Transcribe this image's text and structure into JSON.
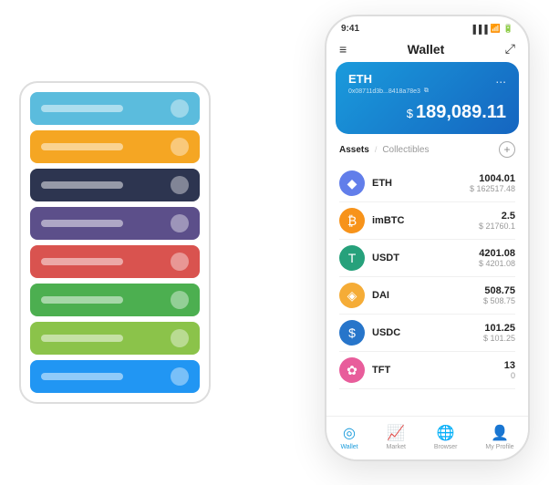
{
  "scene": {
    "cardStack": {
      "cards": [
        {
          "color": "#5bbcdd",
          "iconBg": "rgba(255,255,255,0.4)"
        },
        {
          "color": "#f5a623",
          "iconBg": "rgba(255,255,255,0.4)"
        },
        {
          "color": "#2d3550",
          "iconBg": "rgba(255,255,255,0.4)"
        },
        {
          "color": "#5c4f8a",
          "iconBg": "rgba(255,255,255,0.4)"
        },
        {
          "color": "#d9534f",
          "iconBg": "rgba(255,255,255,0.4)"
        },
        {
          "color": "#4caf50",
          "iconBg": "rgba(255,255,255,0.4)"
        },
        {
          "color": "#8bc34a",
          "iconBg": "rgba(255,255,255,0.4)"
        },
        {
          "color": "#2196f3",
          "iconBg": "rgba(255,255,255,0.4)"
        }
      ]
    },
    "phone": {
      "statusBar": {
        "time": "9:41",
        "signal": "▐▐▐",
        "wifi": "wifi",
        "battery": "▭"
      },
      "header": {
        "menuIcon": "≡",
        "title": "Wallet",
        "expandIcon": "⤢"
      },
      "ethCard": {
        "title": "ETH",
        "moreIcon": "...",
        "address": "0x08711d3b...8418a78e3",
        "addressIcon": "⧉",
        "currencySymbol": "$",
        "amount": "189,089.11"
      },
      "assets": {
        "tabActive": "Assets",
        "tabDivider": "/",
        "tabInactive": "Collectibles",
        "addButtonLabel": "+"
      },
      "assetList": [
        {
          "name": "ETH",
          "iconColor": "#627eea",
          "iconSymbol": "♦",
          "amountMain": "1004.01",
          "amountUsd": "$ 162517.48"
        },
        {
          "name": "imBTC",
          "iconColor": "#f7931a",
          "iconSymbol": "₿",
          "amountMain": "2.5",
          "amountUsd": "$ 21760.1"
        },
        {
          "name": "USDT",
          "iconColor": "#26a17b",
          "iconSymbol": "T",
          "amountMain": "4201.08",
          "amountUsd": "$ 4201.08"
        },
        {
          "name": "DAI",
          "iconColor": "#f5ac37",
          "iconSymbol": "◈",
          "amountMain": "508.75",
          "amountUsd": "$ 508.75"
        },
        {
          "name": "USDC",
          "iconColor": "#2775ca",
          "iconSymbol": "$",
          "amountMain": "101.25",
          "amountUsd": "$ 101.25"
        },
        {
          "name": "TFT",
          "iconColor": "#e85d9b",
          "iconSymbol": "✿",
          "amountMain": "13",
          "amountUsd": "0"
        }
      ],
      "nav": [
        {
          "icon": "◎",
          "label": "Wallet",
          "active": true
        },
        {
          "icon": "📈",
          "label": "Market",
          "active": false
        },
        {
          "icon": "🌐",
          "label": "Browser",
          "active": false
        },
        {
          "icon": "👤",
          "label": "My Profile",
          "active": false
        }
      ]
    }
  }
}
